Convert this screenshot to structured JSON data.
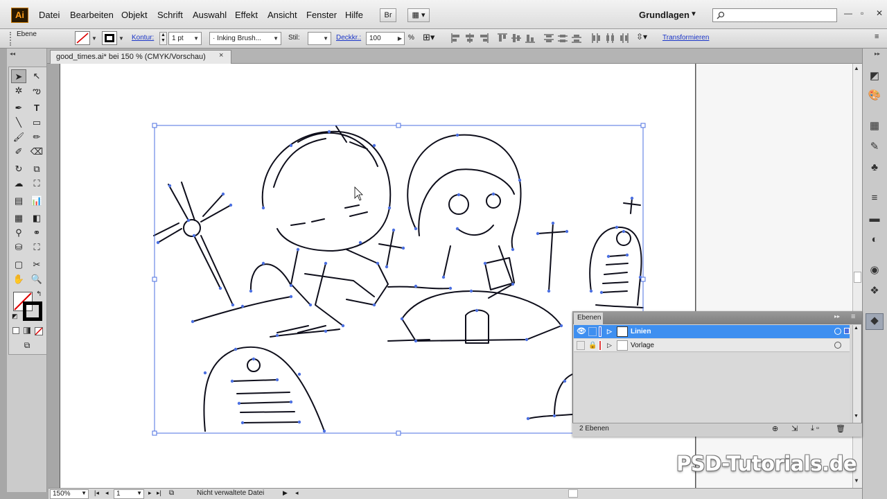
{
  "app": {
    "logo": "Ai"
  },
  "menu": [
    "Datei",
    "Bearbeiten",
    "Objekt",
    "Schrift",
    "Auswahl",
    "Effekt",
    "Ansicht",
    "Fenster",
    "Hilfe"
  ],
  "topbar": {
    "bridge_label": "Br",
    "workspace": "Grundlagen"
  },
  "control": {
    "selection_label": "Ebene",
    "stroke_label": "Kontur:",
    "stroke_weight": "1 pt",
    "brush": "Inking Brush...",
    "style_label": "Stil:",
    "opacity_label": "Deckkr.:",
    "opacity_value": "100",
    "percent": "%",
    "transform_link": "Transformieren"
  },
  "document": {
    "tab_title": "good_times.ai* bei 150 % (CMYK/Vorschau)",
    "close": "×"
  },
  "layers_panel": {
    "tab": "Ebenen",
    "layers": [
      {
        "name": "Linien",
        "selected": true,
        "color": "#4b6fe0"
      },
      {
        "name": "Vorlage",
        "selected": false,
        "color": "#e23a3a"
      }
    ],
    "count": "2 Ebenen"
  },
  "status": {
    "zoom": "150%",
    "page": "1",
    "file_status": "Nicht verwaltete Datei"
  },
  "watermark": "PSD-Tutorials.de",
  "colors": {
    "selection": "#4b6fe0",
    "accent": "#3e8ff0",
    "logo_orange": "#ff9d1a"
  }
}
